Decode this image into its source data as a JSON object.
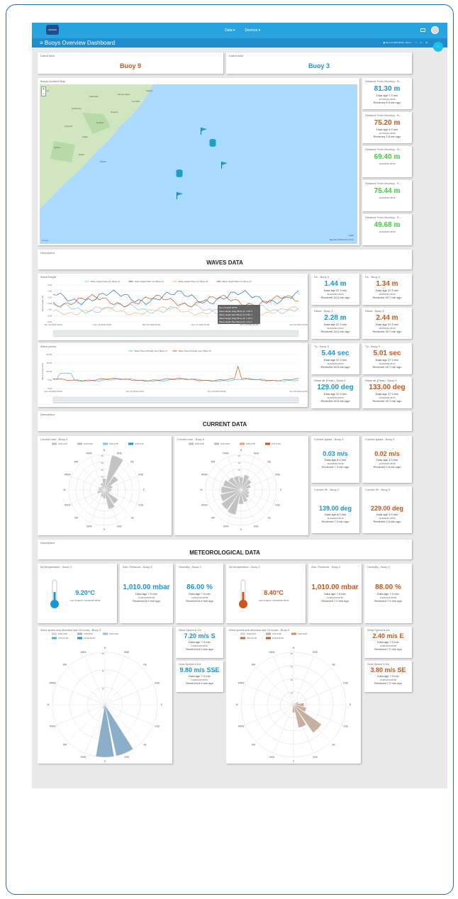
{
  "nav": {
    "logo": "SIGMOS",
    "data_menu": "Data ▾",
    "devices_menu": "Devices ▾"
  },
  "header": {
    "title": "≡ Buoys Overview Dashboard",
    "time_range": "▦ Nov 13 2019 00:59 - Now ▾",
    "back": "‹"
  },
  "latest": [
    {
      "title": "Latest data",
      "buoy": "Buoy 9",
      "color": "#c8571d"
    },
    {
      "title": "Latest data",
      "buoy": "Buoy 3",
      "color": "#1a96d4"
    }
  ],
  "map": {
    "title": "Buoys location Map",
    "zoom_in": "+",
    "zoom_out": "−",
    "attribution": "Google",
    "map_data": "Map data ©2019   Terms of Use",
    "leaflet": "Leaflet",
    "places": [
      "Kalamata",
      "Kardamyli",
      "Areopoli",
      "Gytheio",
      "Neapoli",
      "Kythira",
      "Skala",
      "Molaoi",
      "Monemvasia",
      "Leonidio",
      "Nafplio",
      "Tripoli",
      "Sparti"
    ]
  },
  "distances": [
    {
      "title": "Distance From Mooring - B...",
      "value": "81.30 m",
      "color": "#1a96d4",
      "lines": [
        "Data age 7.0 min",
        "11/20/2019 08:59",
        "Recieved 6.9 min ago"
      ]
    },
    {
      "title": "Distance From Mooring - B...",
      "value": "75.20 m",
      "color": "#c8571d",
      "lines": [
        "Data age 3.0 min",
        "11/20/2019 08:59",
        "Recieved 2.6 min ago"
      ]
    },
    {
      "title": "Distance From Mooring - N...",
      "value": "69.40 m",
      "color": "#3ecf3e",
      "lines": [
        "11/20/2019 08:59"
      ]
    },
    {
      "title": "Distance From Mooring - E...",
      "value": "75.44 m",
      "color": "#3ecf3e",
      "lines": [
        "11/20/2019 08:59"
      ]
    },
    {
      "title": "Distance From Mooring - E...",
      "value": "49.68 m",
      "color": "#3ecf3e",
      "lines": [
        "11/20/2019 08:59"
      ]
    }
  ],
  "waves_section": {
    "desc": "Description",
    "title": "WAVES DATA"
  },
  "wave_height": {
    "title": "Wave height",
    "legend": [
      "Wave Height (Sig) (m) (Buoy 3)",
      "Wave Height Max (m) (Buoy 3)",
      "Wave Height (Sig) (m) (Buoy 9)",
      "Wave Height Max (m) (Buoy 9)"
    ],
    "yticks": [
      "3.00",
      "2.50",
      "2.00",
      "1.50",
      "1.00",
      "0.50",
      "0.00"
    ],
    "ylabel": "Wave Height (m)",
    "xticks": [
      "Nov 13 2019 00:00",
      "Nov 14 2019 12:00",
      "Nov 16 2019 00:00",
      "Nov 17 2019 12:00",
      "Nov 19 2019 00:00",
      "Nov 20 2019 12:00"
    ],
    "tooltip": [
      "Nov 20 2019 00:59",
      "Wave Height (Sig) (Buoy 3): 1.59 m",
      "Wave Height Max (Buoy 3): 2.55 m",
      "Wave Height (Sig) (Buoy 9): 1.29 m",
      "Wave Height Max (Buoy 9): 2.14 m"
    ]
  },
  "wave_period": {
    "title": "Wave period",
    "legend": [
      "Wave Period (Peak) (sec) (Buoy 3)",
      "Wave Period (Peak) (sec) (Buoy 9)"
    ],
    "yticks": [
      "20.00",
      "15.00",
      "10.00",
      "5.00",
      "0.00"
    ],
    "ylabel": "Wave Period (sec)",
    "xticks": [
      "Nov 13 2019 00:00",
      "Nov 15 2019 12:00",
      "Nov 18 2019 00:00",
      "Nov 20 2019 12:00"
    ]
  },
  "wave_cards": [
    {
      "title": "Hs - Buoy 3",
      "value": "1.44 m",
      "color": "#1a96d4",
      "lines": [
        "Data age 37.0 min",
        "11/20/2019 08:23",
        "Recieved 18.0 min ago"
      ]
    },
    {
      "title": "Hs - Buoy 9",
      "value": "1.34 m",
      "color": "#c8571d",
      "lines": [
        "Data age 37.0 min",
        "11/20/2019 08:23",
        "Recieved 18.7 min ago"
      ]
    },
    {
      "title": "Hmax - Buoy 3",
      "value": "2.28 m",
      "color": "#1a96d4",
      "lines": [
        "Data age 37.0 min",
        "11/20/2019 08:23",
        "Recieved 18.0 min ago"
      ]
    },
    {
      "title": "Hmax - Buoy 9",
      "value": "2.44 m",
      "color": "#c8571d",
      "lines": [
        "Data age 37.0 min",
        "11/20/2019 08:23",
        "Recieved 18.7 min ago"
      ]
    },
    {
      "title": "Tp - Buoy 3",
      "value": "5.44 sec",
      "color": "#1a96d4",
      "lines": [
        "Data age 37.0 min",
        "11/20/2019 08:23",
        "Recieved 18.0 min ago"
      ]
    },
    {
      "title": "Tp - Buoy 9",
      "value": "5.01 sec",
      "color": "#c8571d",
      "lines": [
        "Data age 37.0 min",
        "11/20/2019 08:23",
        "Recieved 18.7 min ago"
      ]
    },
    {
      "title": "Wave dir (Peak) - Buoy 3",
      "value": "129.00 deg",
      "color": "#1a96d4",
      "lines": [
        "Data age 37.0 min",
        "11/20/2019 08:23",
        "Recieved 18.0 min ago"
      ]
    },
    {
      "title": "Wave dir (Peak) - Buoy 9",
      "value": "133.00 deg",
      "color": "#c8571d",
      "lines": [
        "Data age 37.0 min",
        "11/20/2019 08:23",
        "Recieved 18.7 min ago"
      ]
    }
  ],
  "current_section": {
    "desc": "Description",
    "title": "CURRENT DATA"
  },
  "current_roses": [
    {
      "title": "Current rose - Buoy 3",
      "legend": [
        "0.00-0.25",
        "0.25-0.50",
        "0.50-0.75",
        "0.75-1.00"
      ],
      "colors": [
        "#bfbfbf",
        "#bfbfbf",
        "#7cc8e6",
        "#1a96d4"
      ],
      "petal": "#bdbdbd",
      "rings": [
        "5",
        "10",
        "15",
        "20",
        "25"
      ],
      "values": [
        8,
        25,
        12,
        6,
        5,
        4,
        12,
        14,
        6,
        5,
        3,
        5,
        4,
        4,
        3,
        5
      ]
    },
    {
      "title": "Current rose - Buoy 9",
      "legend": [
        "0.00-0.25",
        "0.25-0.50",
        "0.50-0.75",
        "0.75-1.00"
      ],
      "colors": [
        "#bfbfbf",
        "#bfbfbf",
        "#e8a070",
        "#c8571d"
      ],
      "petal": "#bdbdbd",
      "rings": [
        "5",
        "10",
        "15",
        "20",
        "25"
      ],
      "values": [
        9,
        11,
        9,
        7,
        5,
        6,
        7,
        9,
        10,
        18,
        17,
        15,
        14,
        13,
        11,
        10
      ]
    }
  ],
  "compass": [
    "N",
    "NNE",
    "NE",
    "ENE",
    "E",
    "ESE",
    "SE",
    "SSE",
    "S",
    "SSW",
    "SW",
    "WSW",
    "W",
    "WNW",
    "NW",
    "NNW"
  ],
  "current_cards": [
    {
      "title": "Current speed - Buoy 3",
      "value": "0.03 m/s",
      "color": "#1a96d4",
      "lines": [
        "Data age 8.0 min",
        "11/20/2019 08:49",
        "Recieved 7.0 min ago"
      ]
    },
    {
      "title": "Current speed - Buoy 9",
      "value": "0.02 m/s",
      "color": "#c8571d",
      "lines": [
        "Data age 3.0 min",
        "11/20/2019 08:59",
        "Recieved 2.6 min ago"
      ]
    },
    {
      "title": "Current dir - Buoy 3",
      "value": "139.00 deg",
      "color": "#1a96d4",
      "lines": [
        "Data age 8.0 min",
        "11/20/2019 08:49",
        "Recieved 7.0 min ago"
      ]
    },
    {
      "title": "Current dir - Buoy 9",
      "value": "229.00 deg",
      "color": "#c8571d",
      "lines": [
        "Data age 3.0 min",
        "11/20/2019 08:59",
        "Recieved 2.6 min ago"
      ]
    }
  ],
  "met_section": {
    "desc": "Description",
    "title": "METEOROLOGICAL DATA"
  },
  "met_temps": [
    {
      "title": "Air temperature - Buoy 3",
      "value": "9.20°C",
      "color": "#1a96d4",
      "updated": "Last Updated: 11/20/2019 08:50"
    },
    {
      "title": "Air temperature - Buoy 9",
      "value": "8.40°C",
      "color": "#c8571d",
      "updated": "Last Updated: 11/20/2019 08:50"
    }
  ],
  "met_cards": [
    {
      "title": "Atm. Pressure - Buoy 3",
      "value": "1,010.00 mbar",
      "color": "#1a96d4",
      "lines": [
        "Data age 7.0 min",
        "11/20/2019 08:50",
        "Recieved 6.9 min ago"
      ]
    },
    {
      "title": "Humidity - Buoy 3",
      "value": "86.00 %",
      "color": "#1a96d4",
      "lines": [
        "Data age 7.0 min",
        "11/20/2019 08:50",
        "Recieved 6.9 min ago"
      ]
    },
    {
      "title": "Atm. Pressure - Buoy 9",
      "value": "1,010.00 mbar",
      "color": "#c8571d",
      "lines": [
        "Data age 7.0 min",
        "11/20/2019 08:50",
        "Recieved 7.0 min ago"
      ]
    },
    {
      "title": "Humidity - Buoy 9",
      "value": "88.00 %",
      "color": "#c8571d",
      "lines": [
        "Data age 7.0 min",
        "11/20/2019 08:50",
        "Recieved 7.0 min ago"
      ]
    }
  ],
  "wind_roses": [
    {
      "title": "Wind speed and direction last 24 hours - Buoy 3",
      "legend": [
        "0.00-3.00",
        "3.00-6.00",
        "6.00-9.00",
        "9.00-12.00",
        "12.00-15.00"
      ],
      "colors": [
        "#d0d0d0",
        "#b0b0b0",
        "#8fc0dc",
        "#5aa8d8",
        "#1a96d4"
      ],
      "petal": "#7fa6c4",
      "rings": [
        "20",
        "40",
        "60"
      ],
      "values": [
        0,
        0,
        0,
        0,
        0,
        0,
        0,
        60,
        70,
        4,
        0,
        0,
        0,
        0,
        0,
        0
      ]
    },
    {
      "title": "Wind speed and direction last 24 hours - Buoy 9",
      "legend": [
        "0.00-3.00",
        "3.00-6.00",
        "6.00-9.00",
        "9.00-12.00",
        "12.00-15.00"
      ],
      "colors": [
        "#d0d0d0",
        "#b0b0b0",
        "#c09070",
        "#c07040",
        "#c8571d"
      ],
      "petal": "#c2a896",
      "rings": [
        "10",
        "20",
        "30",
        "40"
      ],
      "values": [
        0,
        0,
        0,
        4,
        8,
        10,
        26,
        18,
        6,
        2,
        0,
        0,
        0,
        0,
        0,
        0
      ]
    }
  ],
  "wind_cards": [
    {
      "title": "Wind Speed & Dir",
      "value": "7.20 m/s S",
      "color": "#1a96d4",
      "lines": [
        "Data age 7.0 min",
        "11/20/2019 08:50",
        "Recieved 6.9 min ago"
      ]
    },
    {
      "title": "Gust Speed & Dir",
      "value": "9.80 m/s SSE",
      "color": "#1a96d4",
      "lines": [
        "Data age 7.0 min",
        "11/20/2019 08:50",
        "Recieved 6.9 min ago"
      ]
    },
    {
      "title": "Wind Speed & Dir",
      "value": "2.40 m/s E",
      "color": "#c8571d",
      "lines": [
        "Data age 7.0 min",
        "11/20/2019 08:50",
        "Recieved 7.0 min ago"
      ]
    },
    {
      "title": "Gust Speed & Dir",
      "value": "3.80 m/s SE",
      "color": "#c8571d",
      "lines": [
        "Data age 7.0 min",
        "11/20/2019 08:50",
        "Recieved 7.0 min ago"
      ]
    }
  ]
}
